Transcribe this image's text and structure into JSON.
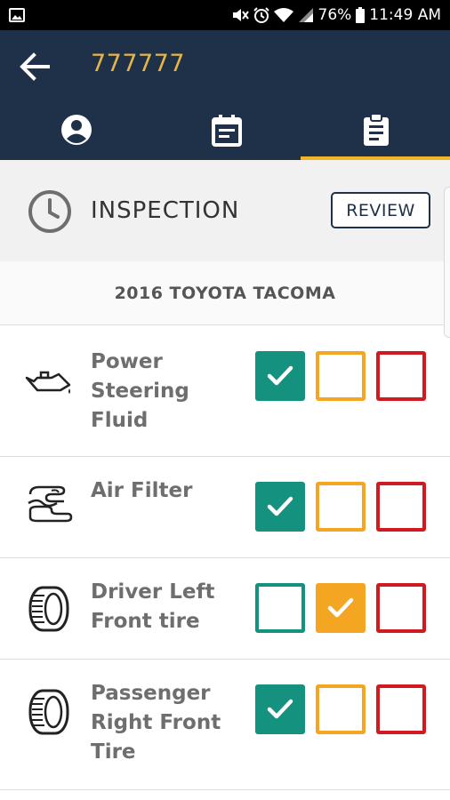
{
  "status_bar": {
    "battery": "76%",
    "time": "11:49 AM",
    "icons": [
      "gallery-icon",
      "mute-icon",
      "alarm-icon",
      "wifi-icon",
      "signal-icon",
      "battery-icon"
    ]
  },
  "app_bar": {
    "title": "777777",
    "tabs": [
      {
        "icon": "person-icon",
        "selected": false
      },
      {
        "icon": "calendar-icon",
        "selected": false
      },
      {
        "icon": "clipboard-icon",
        "selected": true
      }
    ]
  },
  "inspection": {
    "label": "INSPECTION",
    "review_button": "REVIEW",
    "vehicle": "2016 TOYOTA TACOMA"
  },
  "colors": {
    "app_bar": "#1f3049",
    "title": "#e6b54a",
    "tab_indicator": "#f1b52c",
    "pass": "#14917f",
    "warn": "#f4a623",
    "fail": "#cf1a1f"
  },
  "items": [
    {
      "label": "Power Steering Fluid",
      "icon": "oil-can-icon",
      "status": "pass"
    },
    {
      "label": "Air Filter",
      "icon": "air-filter-icon",
      "status": "pass"
    },
    {
      "label": "Driver Left Front tire",
      "icon": "tire-icon",
      "status": "warn"
    },
    {
      "label": "Passenger Right Front Tire",
      "icon": "tire-icon",
      "status": "pass"
    }
  ]
}
